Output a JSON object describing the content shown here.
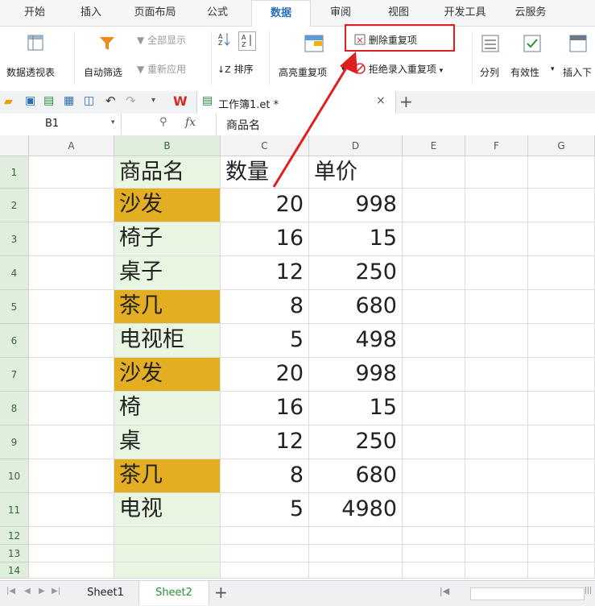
{
  "menu_tabs": [
    {
      "label": "开始"
    },
    {
      "label": "插入"
    },
    {
      "label": "页面布局"
    },
    {
      "label": "公式"
    },
    {
      "label": "数据",
      "active": true
    },
    {
      "label": "审阅"
    },
    {
      "label": "视图"
    },
    {
      "label": "开发工具"
    },
    {
      "label": "云服务"
    }
  ],
  "ribbon": {
    "pivot": "数据透视表",
    "autofilter": "自动筛选",
    "show_all": "全部显示",
    "reapply": "重新应用",
    "sort": "排序",
    "highlight_dup": "高亮重复项",
    "remove_dup": "删除重复项",
    "reject_dup": "拒绝录入重复项",
    "split": "分列",
    "validity": "有效性",
    "insert_dropdown": "插入下"
  },
  "doc_tab": {
    "title": "工作簿1.et *"
  },
  "formula_bar": {
    "name_box": "B1",
    "fx": "fx",
    "content": "商品名"
  },
  "columns": [
    "A",
    "B",
    "C",
    "D",
    "E",
    "F",
    "G"
  ],
  "rows": [
    "1",
    "2",
    "3",
    "4",
    "5",
    "6",
    "7",
    "8",
    "9",
    "10",
    "11",
    "12",
    "13",
    "14"
  ],
  "table": [
    {
      "name": "商品名",
      "qty": "数量",
      "price": "单价",
      "dup": false
    },
    {
      "name": "沙发",
      "qty": "20",
      "price": "998",
      "dup": true
    },
    {
      "name": "椅子",
      "qty": "16",
      "price": "15",
      "dup": false
    },
    {
      "name": "桌子",
      "qty": "12",
      "price": "250",
      "dup": false
    },
    {
      "name": "茶几",
      "qty": "8",
      "price": "680",
      "dup": true
    },
    {
      "name": "电视柜",
      "qty": "5",
      "price": "498",
      "dup": false
    },
    {
      "name": "沙发",
      "qty": "20",
      "price": "998",
      "dup": true
    },
    {
      "name": "椅",
      "qty": "16",
      "price": "15",
      "dup": false
    },
    {
      "name": "桌",
      "qty": "12",
      "price": "250",
      "dup": false
    },
    {
      "name": "茶几",
      "qty": "8",
      "price": "680",
      "dup": true
    },
    {
      "name": "电视",
      "qty": "5",
      "price": "4980",
      "dup": false
    }
  ],
  "sheets": [
    {
      "label": "Sheet1"
    },
    {
      "label": "Sheet2",
      "active": true
    }
  ],
  "colors": {
    "dup_fill": "#e3ae22",
    "col_b_fill": "#e8f5e1",
    "selection_border": "#4c9a3c",
    "annotation": "#e02020"
  }
}
